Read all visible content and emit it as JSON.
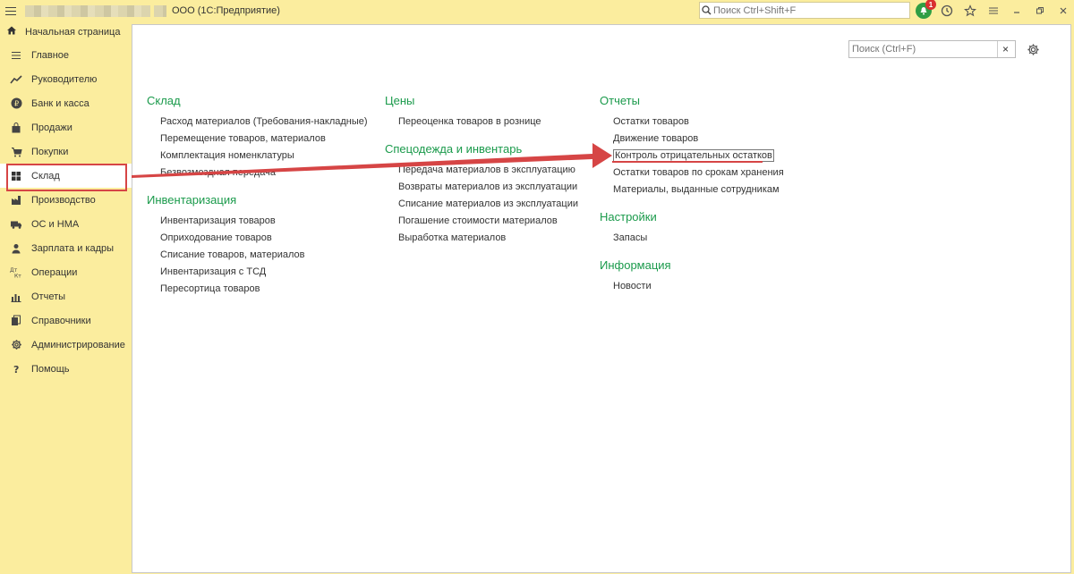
{
  "titlebar": {
    "title": "ООО  (1С:Предприятие)",
    "search_placeholder": "Поиск Ctrl+Shift+F",
    "notification_count": "1",
    "icons": [
      "menu-icon",
      "search-icon",
      "bell-icon",
      "history-icon",
      "star-icon",
      "more-icon",
      "minimize-icon",
      "restore-icon",
      "close-icon"
    ]
  },
  "home_tab": {
    "label": "Начальная страница",
    "icon": "home-icon"
  },
  "sidebar": {
    "items": [
      {
        "label": "Главное",
        "icon": "list-icon"
      },
      {
        "label": "Руководителю",
        "icon": "trend-icon"
      },
      {
        "label": "Банк и касса",
        "icon": "ruble-icon"
      },
      {
        "label": "Продажи",
        "icon": "bag-icon"
      },
      {
        "label": "Покупки",
        "icon": "cart-icon"
      },
      {
        "label": "Склад",
        "icon": "warehouse-icon"
      },
      {
        "label": "Производство",
        "icon": "factory-icon"
      },
      {
        "label": "ОС и НМА",
        "icon": "truck-icon"
      },
      {
        "label": "Зарплата и кадры",
        "icon": "person-icon"
      },
      {
        "label": "Операции",
        "icon": "dt-kt-icon"
      },
      {
        "label": "Отчеты",
        "icon": "chart-icon"
      },
      {
        "label": "Справочники",
        "icon": "books-icon"
      },
      {
        "label": "Администрирование",
        "icon": "gear-icon"
      },
      {
        "label": "Помощь",
        "icon": "question-icon"
      }
    ],
    "active_index": 5
  },
  "panel": {
    "search_placeholder": "Поиск (Ctrl+F)",
    "clear_label": "×"
  },
  "columns": [
    {
      "sections": [
        {
          "title": "Склад",
          "items": [
            "Расход материалов (Требования-накладные)",
            "Перемещение товаров, материалов",
            "Комплектация номенклатуры",
            "Безвозмездная передача"
          ]
        },
        {
          "title": "Инвентаризация",
          "items": [
            "Инвентаризация товаров",
            "Оприходование товаров",
            "Списание товаров, материалов",
            "Инвентаризация с ТСД",
            "Пересортица товаров"
          ]
        }
      ]
    },
    {
      "sections": [
        {
          "title": "Цены",
          "items": [
            "Переоценка товаров в рознице"
          ]
        },
        {
          "title": "Спецодежда и инвентарь",
          "items": [
            "Передача материалов в эксплуатацию",
            "Возвраты материалов из эксплуатации",
            "Списание материалов из эксплуатации",
            "Погашение стоимости материалов",
            "Выработка материалов"
          ]
        }
      ]
    },
    {
      "sections": [
        {
          "title": "Отчеты",
          "items": [
            "Остатки товаров",
            "Движение товаров",
            "Контроль отрицательных остатков",
            "Остатки товаров по срокам хранения",
            "Материалы, выданные сотрудникам"
          ]
        },
        {
          "title": "Настройки",
          "items": [
            "Запасы"
          ]
        },
        {
          "title": "Информация",
          "items": [
            "Новости"
          ]
        }
      ]
    }
  ],
  "highlighted_item": "Контроль отрицательных остатков",
  "colors": {
    "sidebar_bg": "#fbed9e",
    "section_title": "#1a9a4b",
    "annotation_red": "#d64545",
    "badge": "#d93030"
  }
}
